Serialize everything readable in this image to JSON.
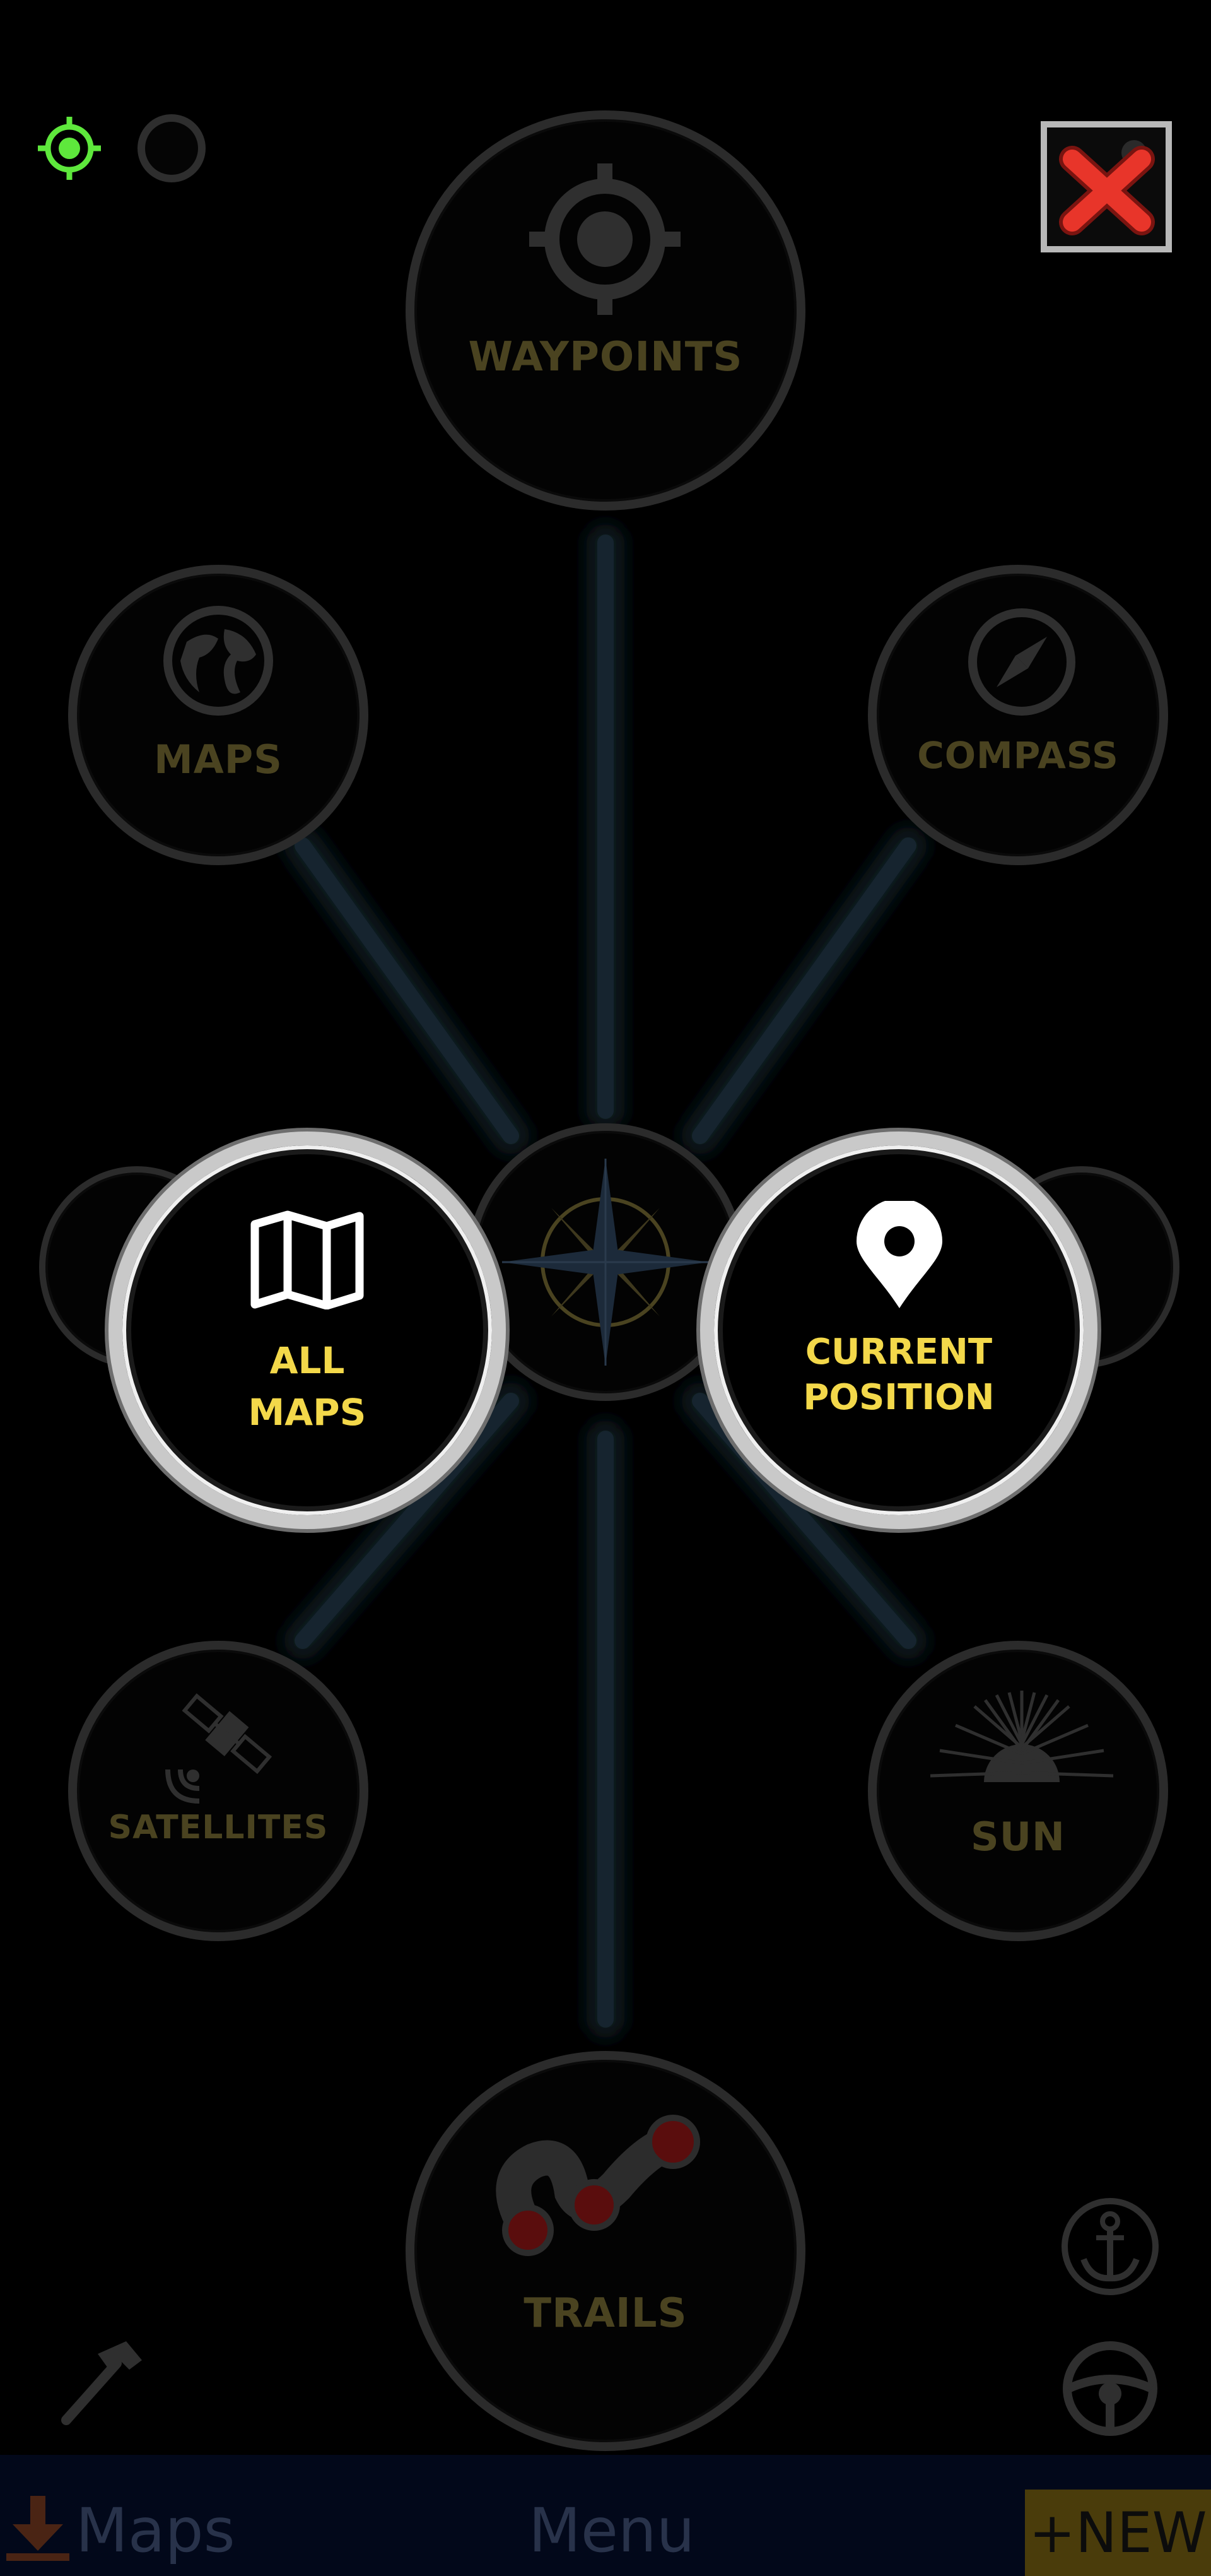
{
  "menu": {
    "waypoints": "WAYPOINTS",
    "maps": "MAPS",
    "compass": "COMPASS",
    "satellites": "SATELLITES",
    "sun": "SUN",
    "trails": "TRAILS"
  },
  "active": {
    "all_maps_line1": "ALL",
    "all_maps_line2": "MAPS",
    "current_position_line1": "CURRENT",
    "current_position_line2": "POSITION"
  },
  "bottom_bar": {
    "maps": "Maps",
    "menu": "Menu",
    "new": "+NEW"
  },
  "colors": {
    "accent": "#f3d84a",
    "gps_active": "#5ee83c",
    "close": "#e8352a"
  },
  "icons": [
    "gps-target-icon",
    "gps-inactive-icon",
    "close-icon",
    "waypoint-target-icon",
    "globe-icon",
    "compass-needle-icon",
    "compass-rose-icon",
    "folded-map-icon",
    "location-pin-icon",
    "satellite-icon",
    "sunrise-icon",
    "trail-icon",
    "anchor-icon",
    "steering-wheel-icon",
    "hammer-icon",
    "download-icon"
  ]
}
